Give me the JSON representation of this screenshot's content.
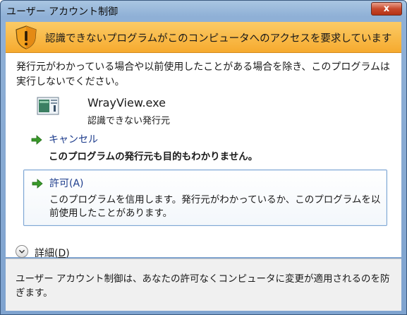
{
  "window": {
    "title": "ユーザー アカウント制御",
    "close_label": "x"
  },
  "banner": {
    "message": "認識できないプログラムがこのコンピュータへのアクセスを要求しています"
  },
  "intro": {
    "text": "発行元がわかっている場合や以前使用したことがある場合を除き、このプログラムは実行しないでください。"
  },
  "program": {
    "name": "WrayView.exe",
    "publisher": "認識できない発行元"
  },
  "options": {
    "cancel": {
      "title": "キャンセル",
      "description": "このプログラムの発行元も目的もわかりません。"
    },
    "allow": {
      "title": "許可(A)",
      "description": "このプログラムを信用します。発行元がわかっているか、このプログラムを以前使用したことがあります。"
    }
  },
  "details": {
    "label_prefix": "詳細(",
    "label_key": "D",
    "label_suffix": ")"
  },
  "footer": {
    "text": "ユーザー アカウント制御は、あなたの許可なくコンピュータに変更が適用されるのを防ぎます。"
  },
  "colors": {
    "banner_top": "#fbcb66",
    "banner_bottom": "#f6aa2e",
    "link_blue": "#1d3c8c",
    "arrow_green": "#3a9a2a"
  }
}
